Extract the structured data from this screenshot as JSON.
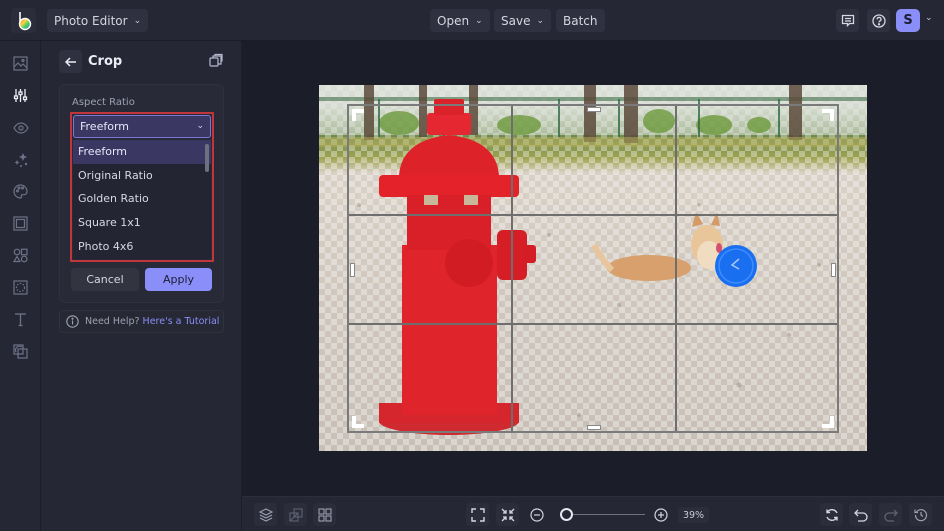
{
  "topbar": {
    "app_menu_label": "Photo Editor",
    "open_label": "Open",
    "save_label": "Save",
    "batch_label": "Batch",
    "avatar_initial": "S"
  },
  "rail": {
    "items": [
      "image-icon",
      "adjustments-icon",
      "eye-icon",
      "sparkles-icon",
      "palette-icon",
      "frame-icon",
      "shapes-icon",
      "texture-icon",
      "text-icon",
      "graphics-icon"
    ],
    "active_index": 1
  },
  "panel": {
    "title": "Crop",
    "aspect_ratio_label": "Aspect Ratio",
    "selected_value": "Freeform",
    "options": [
      "Freeform",
      "Original Ratio",
      "Golden Ratio",
      "Square 1x1",
      "Photo 4x6"
    ],
    "selected_option_index": 0,
    "cancel_label": "Cancel",
    "apply_label": "Apply",
    "help_text": "Need Help?",
    "help_link": "Here's a Tutorial"
  },
  "bottombar": {
    "zoom_percent": "39%",
    "zoom_level": 0.08
  },
  "colors": {
    "accent": "#8a8ef8",
    "highlight_outline": "#c0363a",
    "selected_bg": "#3a3863",
    "background": "#1b1d28",
    "panel": "#252734"
  }
}
